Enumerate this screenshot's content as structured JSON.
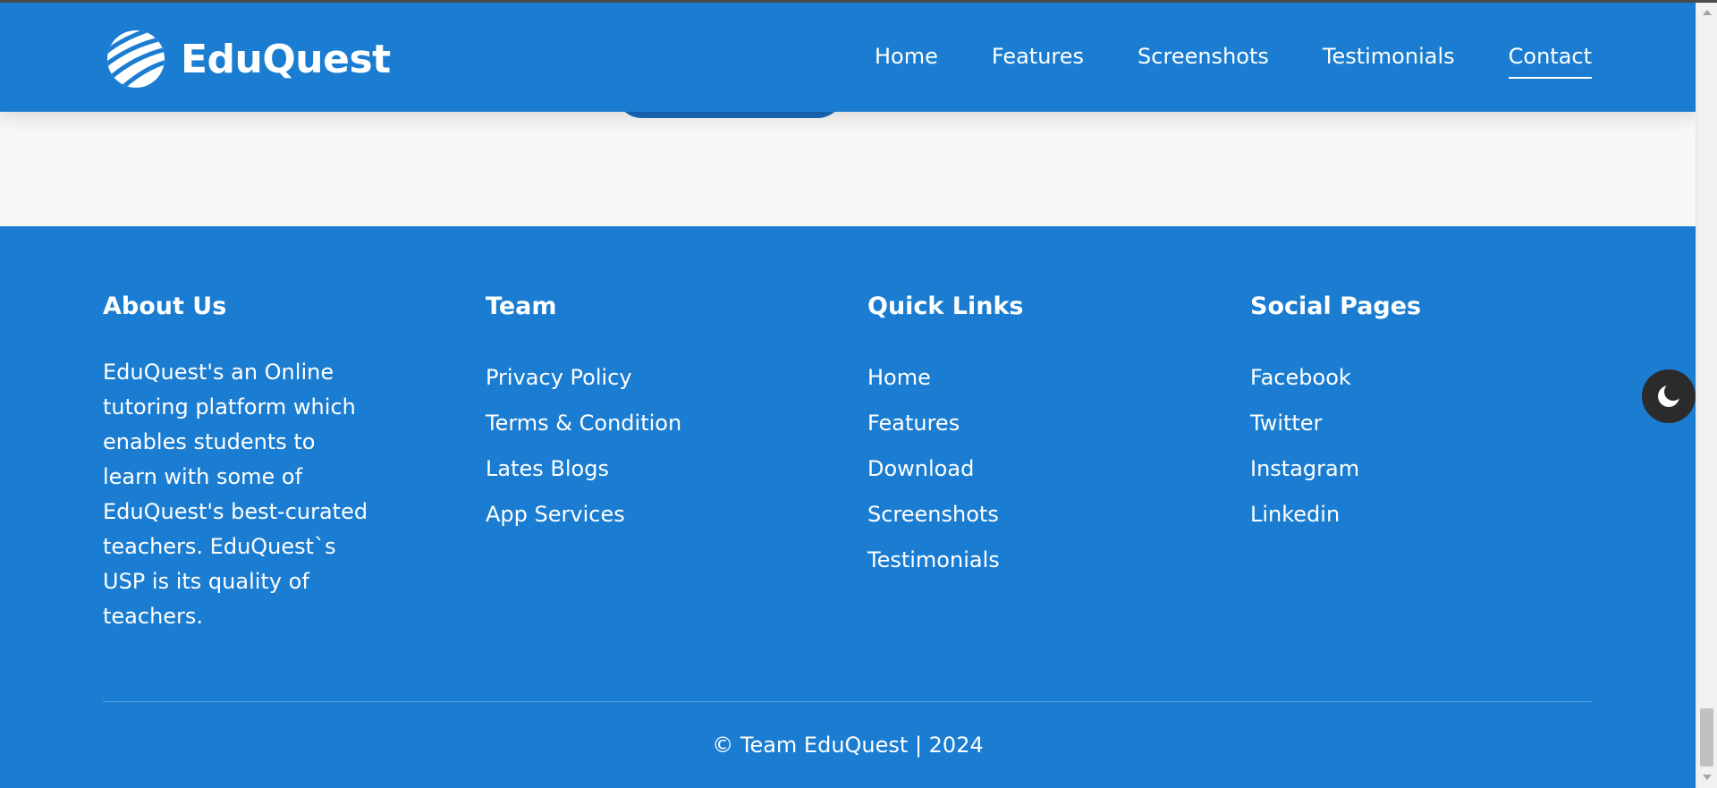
{
  "brand": {
    "name": "EduQuest",
    "logo_icon": "striped-globe-icon"
  },
  "nav": {
    "items": [
      {
        "label": "Home"
      },
      {
        "label": "Features"
      },
      {
        "label": "Screenshots"
      },
      {
        "label": "Testimonials"
      },
      {
        "label": "Contact",
        "active": true
      }
    ]
  },
  "footer": {
    "about": {
      "title": "About Us",
      "text": "EduQuest's an Online tutoring platform which enables students to learn with some of EduQuest's best-curated teachers. EduQuest`s USP is its quality of teachers."
    },
    "team": {
      "title": "Team",
      "links": [
        "Privacy Policy",
        "Terms & Condition",
        "Lates Blogs",
        "App Services"
      ]
    },
    "quick_links": {
      "title": "Quick Links",
      "links": [
        "Home",
        "Features",
        "Download",
        "Screenshots",
        "Testimonials"
      ]
    },
    "social": {
      "title": "Social Pages",
      "links": [
        "Facebook",
        "Twitter",
        "Instagram",
        "Linkedin"
      ]
    },
    "copyright": "© Team EduQuest | 2024"
  },
  "theme_toggle": {
    "icon": "moon-icon"
  },
  "colors": {
    "primary": "#1b7dd1",
    "page_bg": "#f7f7f7",
    "toggle_bg": "#2b2b2b"
  }
}
